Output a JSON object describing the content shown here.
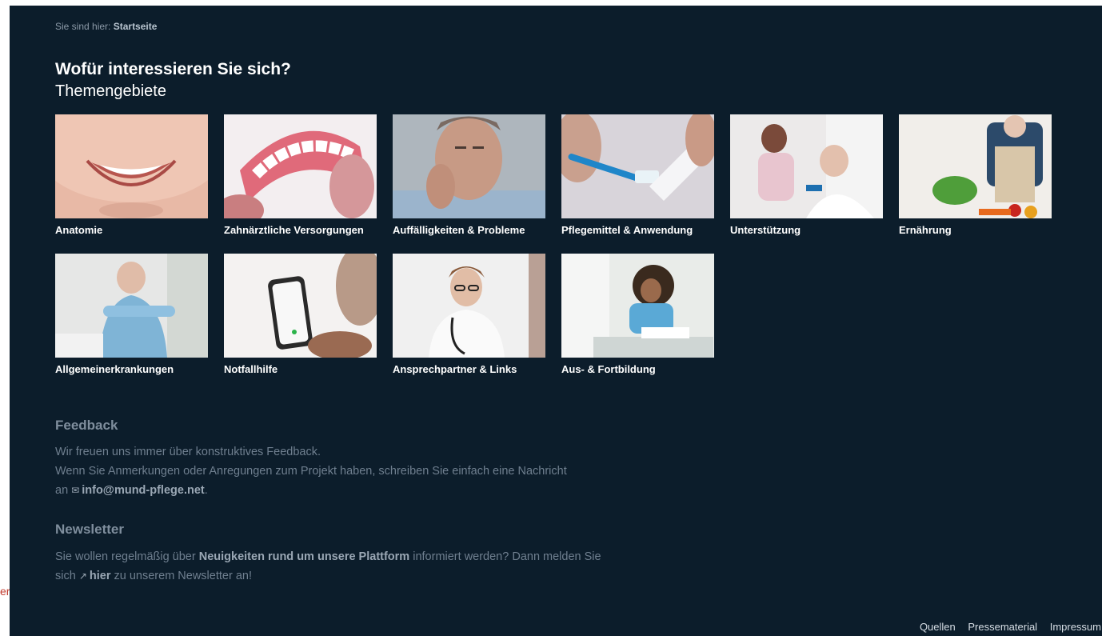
{
  "breadcrumb": {
    "prefix": "Sie sind hier:",
    "current": "Startseite"
  },
  "heading": "Wofür interessieren Sie sich?",
  "subheading": "Themengebiete",
  "topics": [
    {
      "label": "Anatomie",
      "icon": "smile-photo"
    },
    {
      "label": "Zahnärztliche Versorgungen",
      "icon": "denture-photo"
    },
    {
      "label": "Auffälligkeiten & Probleme",
      "icon": "toothache-photo"
    },
    {
      "label": "Pflegemittel & Anwendung",
      "icon": "toothbrush-photo"
    },
    {
      "label": "Unterstützung",
      "icon": "caregiver-photo"
    },
    {
      "label": "Ernährung",
      "icon": "cooking-photo"
    },
    {
      "label": "Allgemeinerkrankungen",
      "icon": "elderly-man-photo"
    },
    {
      "label": "Notfallhilfe",
      "icon": "phone-photo"
    },
    {
      "label": "Ansprechpartner & Links",
      "icon": "doctor-photo"
    },
    {
      "label": "Aus- & Fortbildung",
      "icon": "student-photo"
    }
  ],
  "feedback": {
    "title": "Feedback",
    "line1": "Wir freuen uns immer über konstruktives Feedback.",
    "line2": "Wenn Sie Anmerkungen oder Anregungen zum Projekt haben, schreiben Sie einfach eine Nachricht",
    "line3_prefix": "an",
    "email": "info@mund-pflege.net",
    "line3_suffix": "."
  },
  "newsletter": {
    "title": "Newsletter",
    "line1_prefix": "Sie wollen regelmäßig über",
    "line1_bold": "Neuigkeiten rund um unsere Plattform",
    "line1_suffix": "informiert werden? Dann melden Sie",
    "line2_prefix": "sich",
    "link": "hier",
    "line2_suffix": "zu unserem Newsletter an!"
  },
  "footer": {
    "quellen": "Quellen",
    "presse": "Pressematerial",
    "impressum": "Impressum"
  },
  "side_fragment": "er",
  "colors": {
    "background": "#0c1d2b",
    "text": "#ffffff",
    "muted": "#6f7f8f"
  }
}
